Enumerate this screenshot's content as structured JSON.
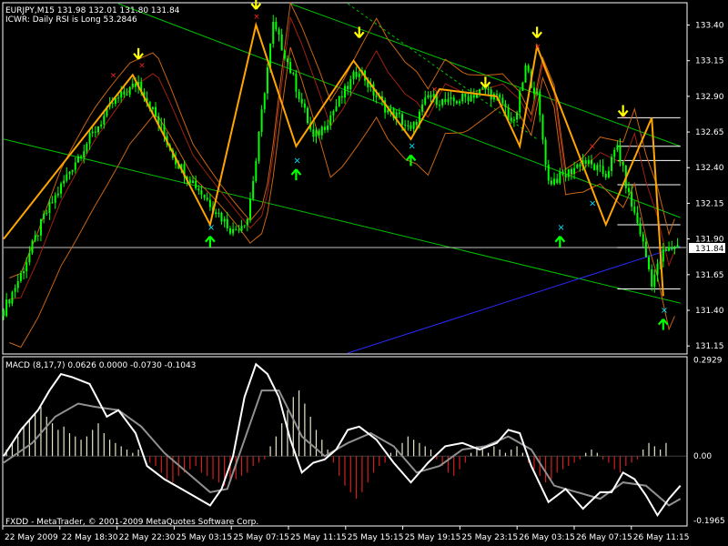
{
  "window": {
    "symbol_line": "EURJPY,M15  131.98 132.01 131.80 131.84",
    "indicator_line": "ICWR: Daily RSI is Long 53.2846",
    "macd_line": "MACD (8,17,7) 0.0626 0.0000 -0.0730 -0.1043",
    "footer": "FXDD - MetaTrader, © 2001-2009 MetaQuotes Software Corp.",
    "current_price": "131.84"
  },
  "colors": {
    "background": "#000000",
    "frame": "#ffffff",
    "candle": "#00ff00",
    "zigzag": "#ffa500",
    "zigzag_red": "#ff3b1f",
    "bands": "#c86414",
    "channel": "#00c000",
    "trend_blue": "#2a2aff",
    "arrow_down": "#ffff00",
    "arrow_up": "#00ff00",
    "marker_red": "#ff2020",
    "marker_cyan": "#00e5ff",
    "macd_line": "#ffffff",
    "signal_line": "#909090",
    "hist_pos": "#e6e6c8",
    "hist_neg": "#d02020"
  },
  "chart_data": [
    {
      "type": "candlestick",
      "title": "EURJPY,M15",
      "x_ticks": [
        "22 May 2009",
        "22 May 18:30",
        "22 May 22:30",
        "25 May 03:15",
        "25 May 07:15",
        "25 May 11:15",
        "25 May 15:15",
        "25 May 19:15",
        "25 May 23:15",
        "26 May 03:15",
        "26 May 07:15",
        "26 May 11:15"
      ],
      "y_ticks": [
        133.4,
        133.15,
        132.9,
        132.65,
        132.4,
        132.15,
        131.9,
        131.65,
        131.4,
        131.15
      ],
      "ylim": [
        131.1,
        133.55
      ],
      "current_price": 131.84,
      "close_path": [
        [
          0,
          131.4
        ],
        [
          6,
          131.65
        ],
        [
          14,
          132.05
        ],
        [
          25,
          132.45
        ],
        [
          38,
          132.85
        ],
        [
          47,
          133.0
        ],
        [
          52,
          132.8
        ],
        [
          60,
          132.45
        ],
        [
          70,
          132.2
        ],
        [
          80,
          131.95
        ],
        [
          85,
          132.05
        ],
        [
          88,
          132.45
        ],
        [
          91,
          132.95
        ],
        [
          94,
          133.4
        ],
        [
          98,
          133.2
        ],
        [
          104,
          132.85
        ],
        [
          108,
          132.6
        ],
        [
          112,
          132.7
        ],
        [
          118,
          132.9
        ],
        [
          124,
          133.1
        ],
        [
          128,
          132.95
        ],
        [
          134,
          132.8
        ],
        [
          138,
          132.75
        ],
        [
          142,
          132.65
        ],
        [
          148,
          132.9
        ],
        [
          155,
          132.85
        ],
        [
          162,
          132.9
        ],
        [
          168,
          132.95
        ],
        [
          174,
          132.85
        ],
        [
          178,
          132.7
        ],
        [
          182,
          133.1
        ],
        [
          186,
          132.9
        ],
        [
          190,
          132.3
        ],
        [
          196,
          132.35
        ],
        [
          202,
          132.45
        ],
        [
          210,
          132.35
        ],
        [
          214,
          132.55
        ],
        [
          218,
          132.2
        ],
        [
          222,
          131.95
        ],
        [
          226,
          131.6
        ],
        [
          230,
          131.8
        ],
        [
          234,
          131.85
        ]
      ],
      "zigzag": [
        [
          0,
          131.9
        ],
        [
          45,
          133.05
        ],
        [
          72,
          132.0
        ],
        [
          88,
          133.4
        ],
        [
          102,
          132.55
        ],
        [
          122,
          133.15
        ],
        [
          142,
          132.6
        ],
        [
          152,
          132.95
        ],
        [
          172,
          132.9
        ],
        [
          180,
          132.55
        ],
        [
          186,
          133.25
        ],
        [
          210,
          132.0
        ],
        [
          226,
          132.75
        ],
        [
          230,
          131.5
        ]
      ],
      "arrows_down": [
        [
          47,
          133.2
        ],
        [
          88,
          133.55
        ],
        [
          124,
          133.35
        ],
        [
          168,
          133.0
        ],
        [
          186,
          133.35
        ],
        [
          216,
          132.8
        ]
      ],
      "arrows_up": [
        [
          72,
          131.88
        ],
        [
          102,
          132.35
        ],
        [
          142,
          132.45
        ],
        [
          194,
          131.88
        ],
        [
          230,
          131.3
        ]
      ],
      "markers_red": [
        [
          38,
          133.05
        ],
        [
          48,
          133.12
        ],
        [
          88,
          133.46
        ],
        [
          150,
          132.95
        ],
        [
          186,
          133.25
        ],
        [
          205,
          132.55
        ],
        [
          216,
          132.77
        ]
      ],
      "markers_cyan": [
        [
          72,
          131.98
        ],
        [
          102,
          132.45
        ],
        [
          142,
          132.55
        ],
        [
          194,
          131.98
        ],
        [
          205,
          132.15
        ],
        [
          230,
          131.4
        ]
      ],
      "fib_levels": [
        132.75,
        132.55,
        132.45,
        132.28,
        132.0,
        131.84,
        131.55
      ]
    },
    {
      "type": "bar_line",
      "title": "MACD (8,17,7)",
      "y_ticks": [
        0.2929,
        0.0,
        -0.1965
      ],
      "ylim": [
        -0.21,
        0.3
      ],
      "macd": [
        [
          0,
          0.0
        ],
        [
          6,
          0.08
        ],
        [
          12,
          0.14
        ],
        [
          16,
          0.2
        ],
        [
          20,
          0.25
        ],
        [
          24,
          0.24
        ],
        [
          30,
          0.22
        ],
        [
          36,
          0.12
        ],
        [
          40,
          0.14
        ],
        [
          46,
          0.07
        ],
        [
          50,
          -0.03
        ],
        [
          56,
          -0.07
        ],
        [
          62,
          -0.1
        ],
        [
          66,
          -0.12
        ],
        [
          72,
          -0.15
        ],
        [
          76,
          -0.1
        ],
        [
          80,
          0.0
        ],
        [
          84,
          0.18
        ],
        [
          88,
          0.28
        ],
        [
          92,
          0.25
        ],
        [
          96,
          0.18
        ],
        [
          100,
          0.05
        ],
        [
          104,
          -0.05
        ],
        [
          108,
          -0.02
        ],
        [
          112,
          -0.01
        ],
        [
          116,
          0.02
        ],
        [
          120,
          0.08
        ],
        [
          124,
          0.09
        ],
        [
          130,
          0.05
        ],
        [
          136,
          -0.02
        ],
        [
          142,
          -0.08
        ],
        [
          148,
          -0.02
        ],
        [
          154,
          0.03
        ],
        [
          160,
          0.04
        ],
        [
          166,
          0.02
        ],
        [
          172,
          0.04
        ],
        [
          176,
          0.08
        ],
        [
          180,
          0.07
        ],
        [
          184,
          -0.03
        ],
        [
          190,
          -0.14
        ],
        [
          196,
          -0.1
        ],
        [
          202,
          -0.16
        ],
        [
          208,
          -0.11
        ],
        [
          212,
          -0.11
        ],
        [
          216,
          -0.05
        ],
        [
          220,
          -0.07
        ],
        [
          224,
          -0.12
        ],
        [
          228,
          -0.18
        ],
        [
          232,
          -0.13
        ],
        [
          236,
          -0.09
        ]
      ],
      "signal": [
        [
          0,
          -0.02
        ],
        [
          10,
          0.04
        ],
        [
          18,
          0.12
        ],
        [
          26,
          0.16
        ],
        [
          32,
          0.15
        ],
        [
          40,
          0.14
        ],
        [
          48,
          0.09
        ],
        [
          56,
          0.01
        ],
        [
          64,
          -0.05
        ],
        [
          72,
          -0.11
        ],
        [
          78,
          -0.1
        ],
        [
          84,
          0.05
        ],
        [
          90,
          0.2
        ],
        [
          96,
          0.2
        ],
        [
          104,
          0.06
        ],
        [
          112,
          0.0
        ],
        [
          120,
          0.04
        ],
        [
          128,
          0.07
        ],
        [
          136,
          0.03
        ],
        [
          144,
          -0.05
        ],
        [
          152,
          -0.03
        ],
        [
          160,
          0.02
        ],
        [
          168,
          0.03
        ],
        [
          176,
          0.06
        ],
        [
          184,
          0.02
        ],
        [
          192,
          -0.09
        ],
        [
          200,
          -0.11
        ],
        [
          208,
          -0.13
        ],
        [
          216,
          -0.08
        ],
        [
          224,
          -0.09
        ],
        [
          232,
          -0.15
        ],
        [
          236,
          -0.13
        ]
      ],
      "histogram": [
        0.02,
        0.04,
        0.06,
        0.09,
        0.11,
        0.13,
        0.15,
        0.12,
        0.1,
        0.08,
        0.09,
        0.07,
        0.06,
        0.05,
        0.06,
        0.08,
        0.1,
        0.07,
        0.05,
        0.04,
        0.03,
        0.02,
        0.01,
        0.02,
        -0.01,
        -0.02,
        -0.03,
        -0.05,
        -0.07,
        -0.08,
        -0.06,
        -0.05,
        -0.04,
        -0.03,
        -0.05,
        -0.06,
        -0.07,
        -0.08,
        -0.09,
        -0.08,
        -0.07,
        -0.06,
        -0.05,
        -0.03,
        -0.02,
        -0.01,
        0.03,
        0.06,
        0.1,
        0.14,
        0.18,
        0.2,
        0.16,
        0.12,
        0.08,
        0.05,
        0.02,
        -0.02,
        -0.06,
        -0.09,
        -0.11,
        -0.13,
        -0.11,
        -0.08,
        -0.05,
        -0.03,
        -0.02,
        0.01,
        0.02,
        0.04,
        0.06,
        0.05,
        0.04,
        0.03,
        0.02,
        -0.01,
        -0.03,
        -0.05,
        -0.06,
        -0.04,
        -0.02,
        0.01,
        0.03,
        0.02,
        0.01,
        0.03,
        0.02,
        0.01,
        0.02,
        0.03,
        0.01,
        -0.02,
        -0.04,
        -0.06,
        -0.08,
        -0.07,
        -0.05,
        -0.04,
        -0.03,
        -0.02,
        -0.01,
        0.01,
        0.02,
        0.01,
        -0.01,
        -0.02,
        -0.04,
        -0.05,
        -0.03,
        -0.02,
        -0.01,
        0.02,
        0.04,
        0.03,
        0.02,
        0.04
      ]
    }
  ]
}
